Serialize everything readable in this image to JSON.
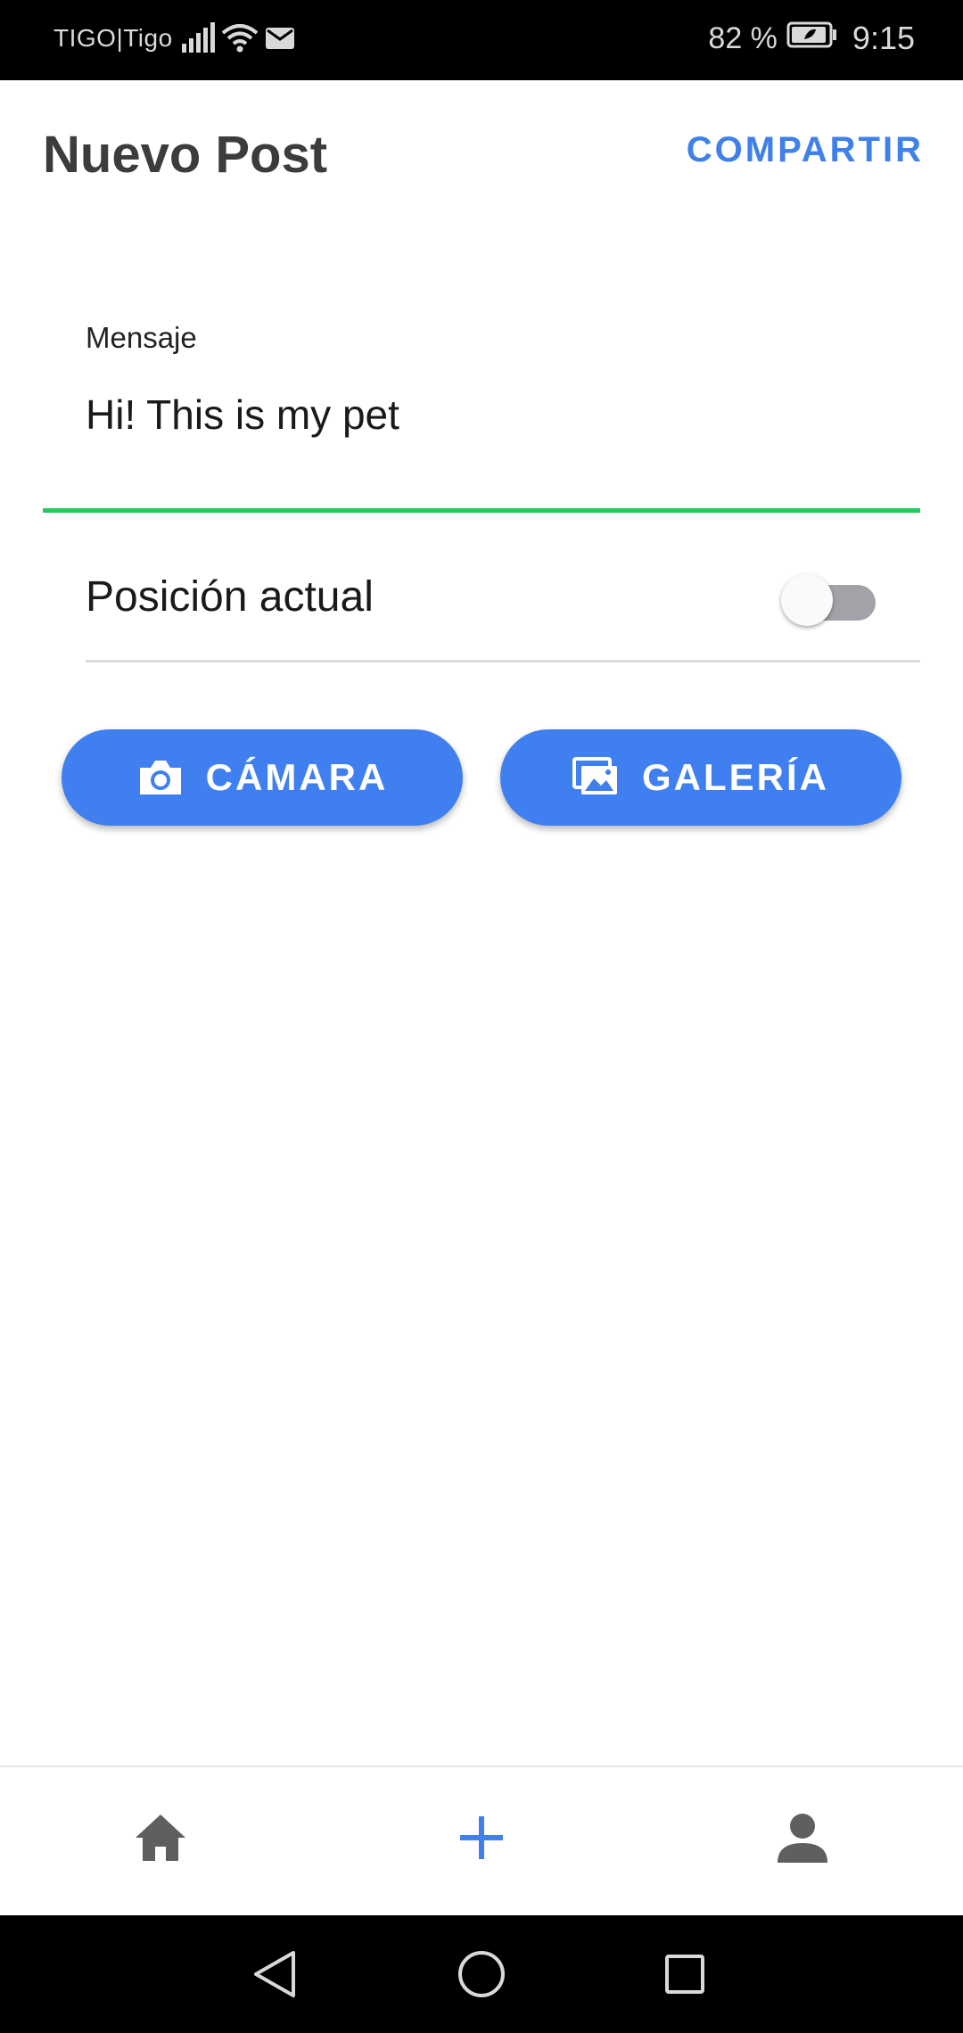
{
  "status_bar": {
    "carrier": "TIGO|Tigo",
    "battery_percent": "82 %",
    "time": "9:15",
    "icons": [
      "signal-icon",
      "wifi-icon",
      "mail-icon",
      "battery-icon"
    ]
  },
  "header": {
    "title": "Nuevo Post",
    "share_label": "COMPARTIR"
  },
  "message_field": {
    "label": "Mensaje",
    "value": "Hi! This is my pet"
  },
  "position_switch": {
    "label": "Posición actual",
    "enabled": false
  },
  "buttons": {
    "camera_label": "CÁMARA",
    "gallery_label": "GALERÍA"
  },
  "bottom_nav": {
    "items": [
      "home-icon",
      "add-icon",
      "person-icon"
    ],
    "active": "add-icon"
  },
  "colors": {
    "accent": "#3f80ea",
    "button": "#3f7ff0",
    "field_underline": "#1ecb5c",
    "title": "#3c3c3c"
  }
}
